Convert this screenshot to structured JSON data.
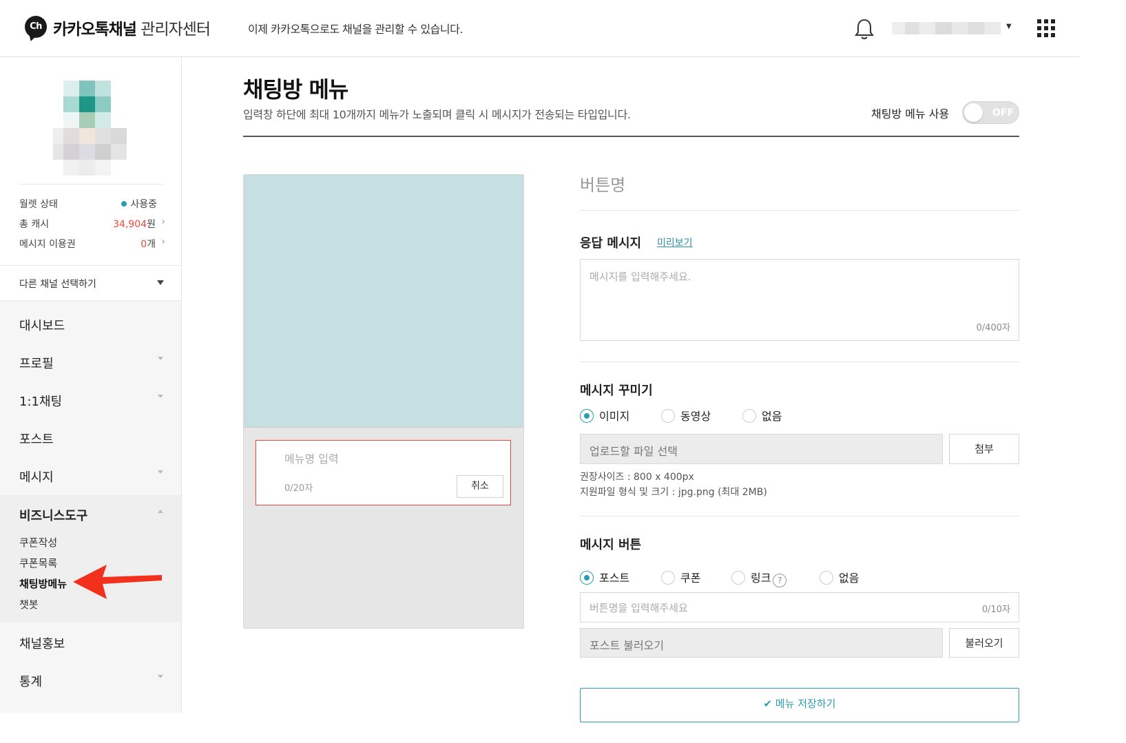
{
  "header": {
    "logo_badge": "Ch",
    "brand_bold": "카카오톡채널",
    "brand_light": "관리자센터",
    "notice": "이제 카카오톡으로도 채널을 관리할 수 있습니다."
  },
  "sidebar": {
    "stats": {
      "wallet_label": "월렛 상태",
      "wallet_value": "사용중",
      "cash_label": "총 캐시",
      "cash_amount": "34,904",
      "cash_unit": "원",
      "ticket_label": "메시지 이용권",
      "ticket_amount": "0",
      "ticket_unit": "개"
    },
    "select_channel": "다른 채널 선택하기",
    "nav": {
      "dashboard": "대시보드",
      "profile": "프로필",
      "chat": "1:1채팅",
      "post": "포스트",
      "message": "메시지",
      "business_tools": "비즈니스도구",
      "coupon_create": "쿠폰작성",
      "coupon_list": "쿠폰목록",
      "chatroom_menu": "채팅방메뉴",
      "chatbot": "챗봇",
      "promotion": "채널홍보",
      "statistics": "통계"
    }
  },
  "main": {
    "title": "채팅방 메뉴",
    "description": "입력창 하단에 최대 10개까지 메뉴가 노출되며 클릭 시 메시지가 전송되는 타입입니다.",
    "toggle_label": "채팅방 메뉴 사용",
    "toggle_state": "OFF",
    "preview": {
      "menu_name_placeholder": "메뉴명 입력",
      "menu_name_count": "0/20자",
      "cancel": "취소"
    },
    "form": {
      "button_name": "버튼명",
      "response_title": "응답 메시지",
      "preview_link": "미리보기",
      "message_placeholder": "메시지를 입력해주세요.",
      "message_count": "0/400자",
      "decorate_title": "메시지 꾸미기",
      "decorate_options": [
        "이미지",
        "동영상",
        "없음"
      ],
      "file_placeholder": "업로드할 파일 선택",
      "attach": "첨부",
      "size_hint": "권장사이즈 : 800 x 400px",
      "format_hint": "지원파일 형식 및 크기 : jpg.png (최대 2MB)",
      "button_title": "메시지 버튼",
      "button_options": [
        "포스트",
        "쿠폰",
        "링크",
        "없음"
      ],
      "help": "?",
      "button_name_placeholder": "버튼명을 입력해주세요",
      "button_name_count": "0/10자",
      "post_load_placeholder": "포스트 불러오기",
      "load": "불러오기",
      "save": "메뉴 저장하기"
    }
  },
  "colors": {
    "accent": "#2a9bb3",
    "alert": "#e64a3b",
    "preview_bg": "#c5dfe2"
  }
}
